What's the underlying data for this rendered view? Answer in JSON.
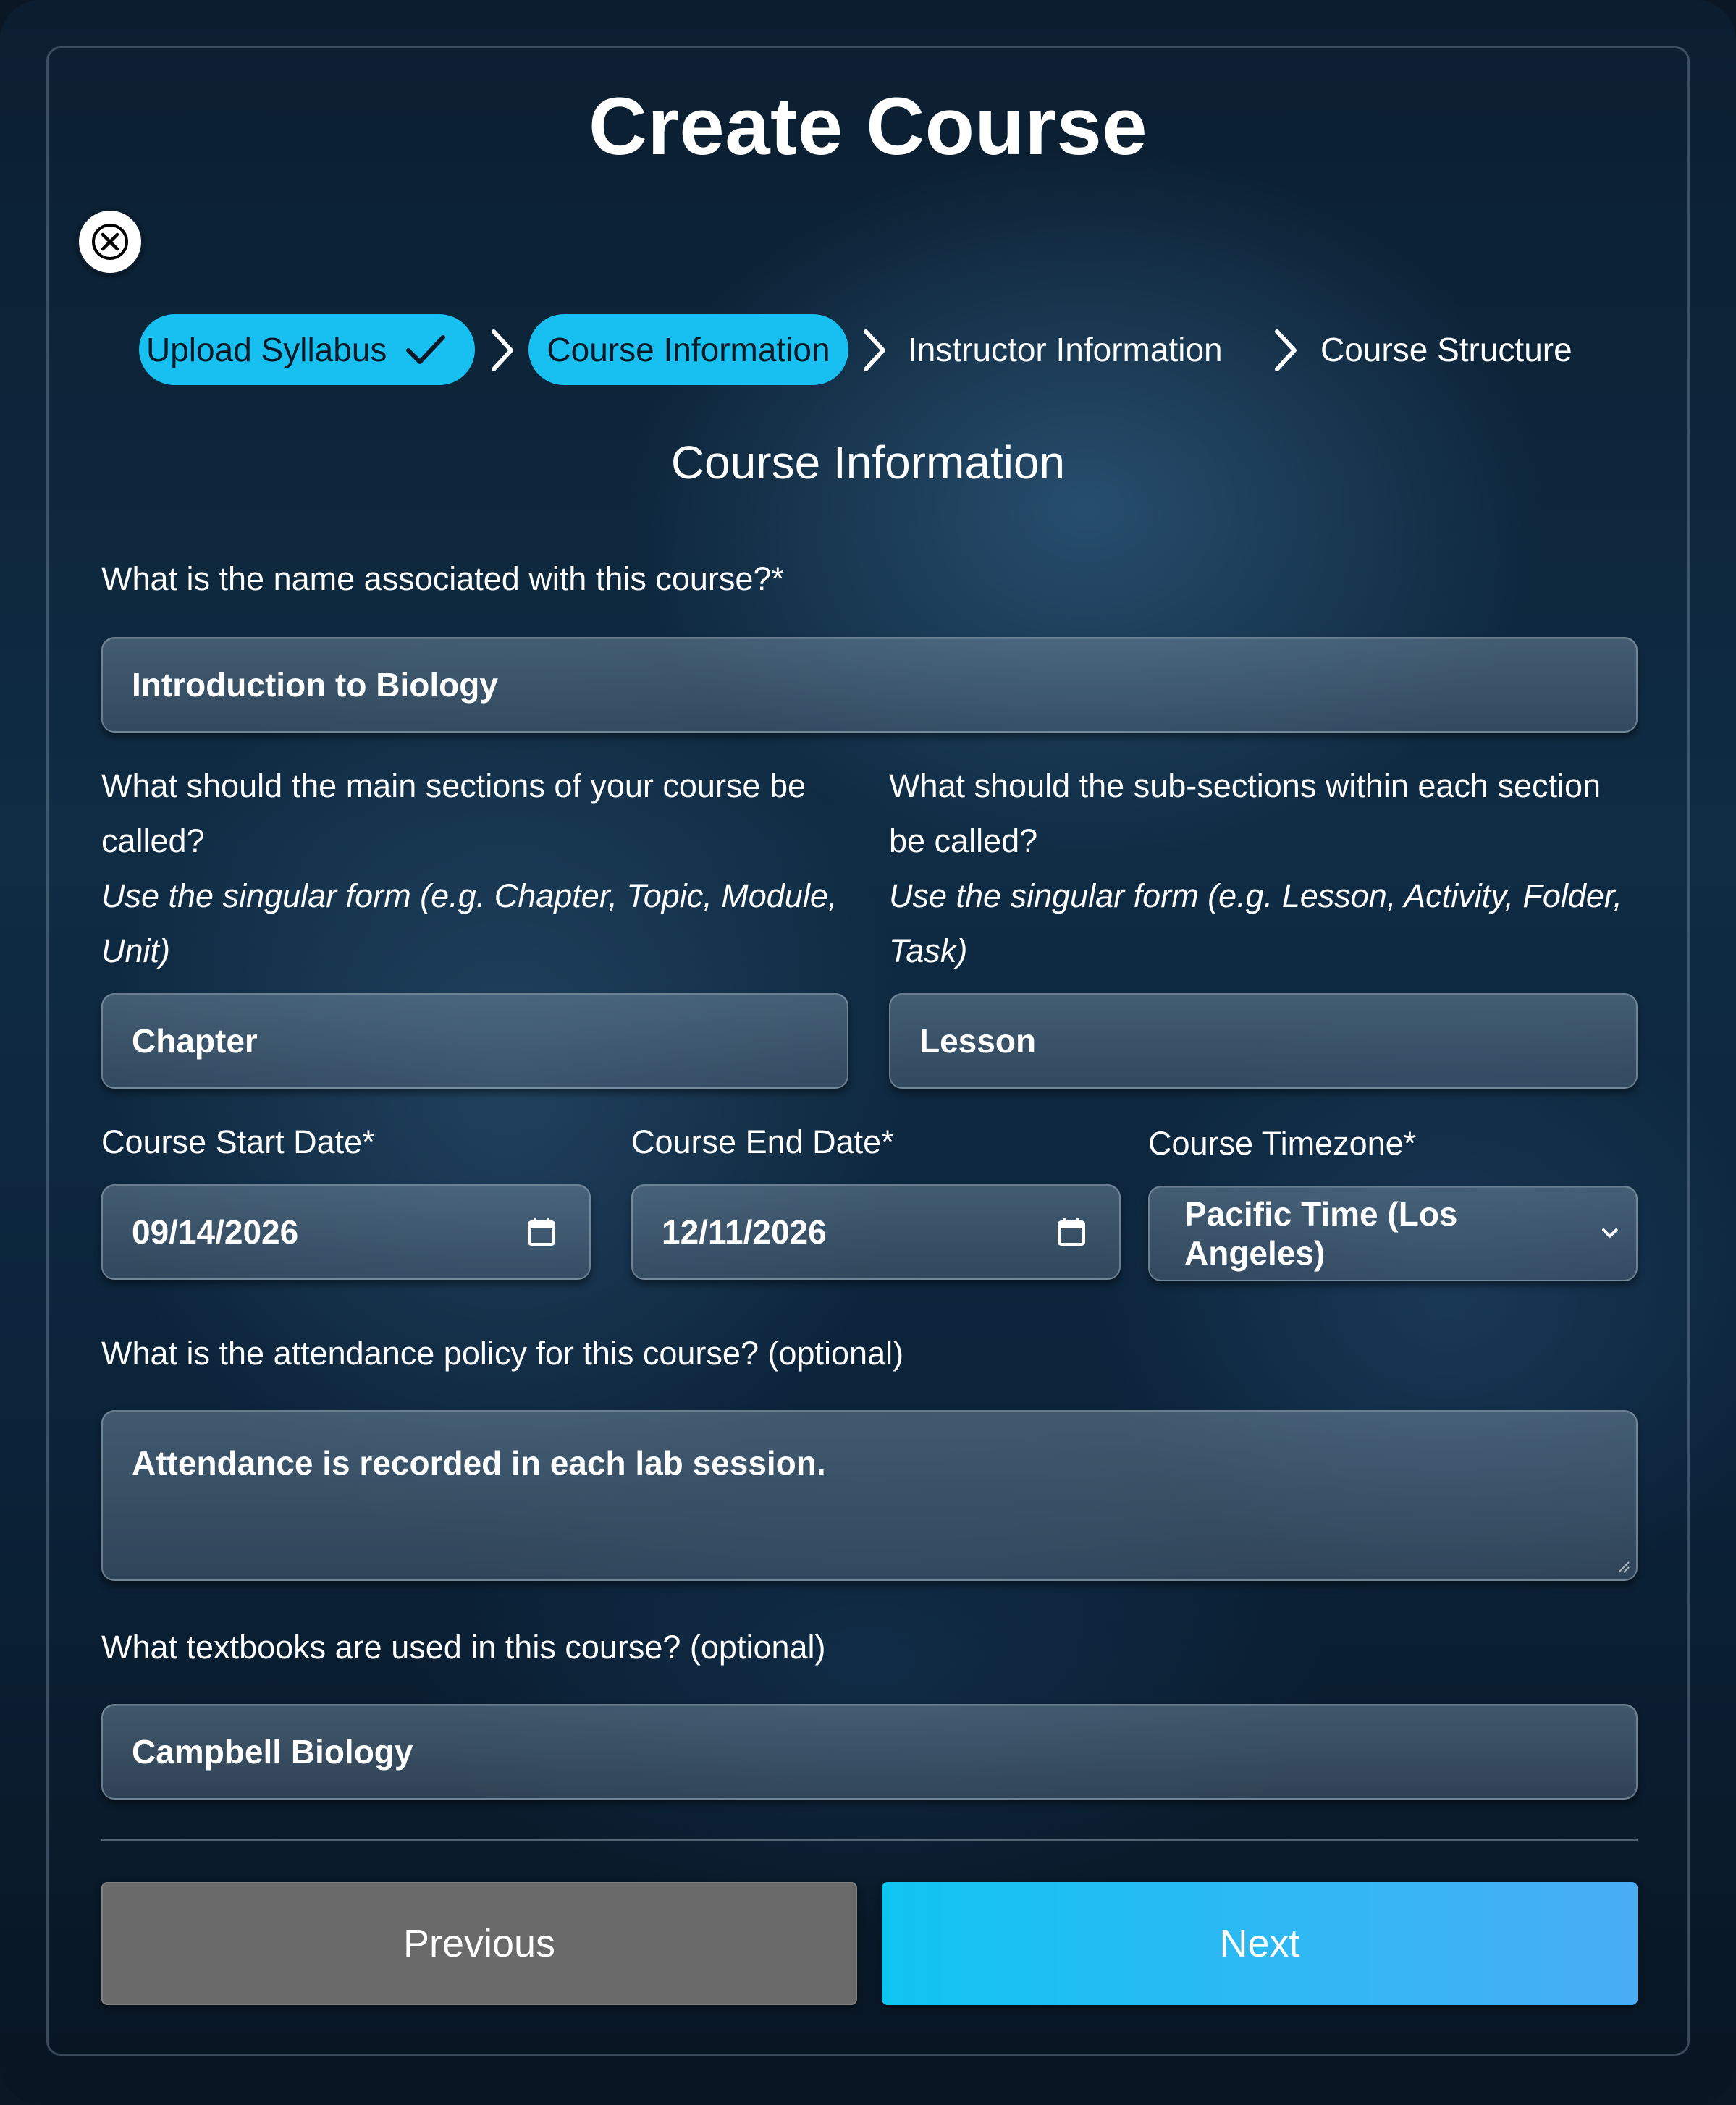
{
  "dialog": {
    "title": "Create Course"
  },
  "stepper": {
    "steps": [
      {
        "label": "Upload Syllabus",
        "state": "completed"
      },
      {
        "label": "Course Information",
        "state": "current"
      },
      {
        "label": "Instructor Information",
        "state": "upcoming"
      },
      {
        "label": "Course Structure",
        "state": "upcoming"
      }
    ]
  },
  "form": {
    "heading": "Course Information",
    "course_name": {
      "label": "What is the name associated with this course?*",
      "value": "Introduction to Biology"
    },
    "main_sections": {
      "label": "What should the main sections of your course be called?",
      "hint": "Use the singular form (e.g. Chapter, Topic, Module, Unit)",
      "value": "Chapter"
    },
    "sub_sections": {
      "label": "What should the sub-sections within each section be called?",
      "hint": "Use the singular form (e.g. Lesson, Activity, Folder, Task)",
      "value": "Lesson"
    },
    "start_date": {
      "label": "Course Start Date*",
      "value": "09/14/2026"
    },
    "end_date": {
      "label": "Course End Date*",
      "value": "12/11/2026"
    },
    "timezone": {
      "label": "Course Timezone*",
      "value": "Pacific Time (Los Angeles)"
    },
    "attendance": {
      "label": "What is the attendance policy for this course? (optional)",
      "value": "Attendance is recorded in each lab session."
    },
    "textbooks": {
      "label": "What textbooks are used in this course? (optional)",
      "value": "Campbell Biology"
    }
  },
  "buttons": {
    "previous": "Previous",
    "next": "Next"
  },
  "colors": {
    "accent": "#17c0f0",
    "button_previous": "#6a6a6a"
  },
  "icons": [
    "close-icon",
    "checkmark-icon",
    "chevron-right-icon",
    "calendar-icon",
    "chevron-down-icon"
  ]
}
